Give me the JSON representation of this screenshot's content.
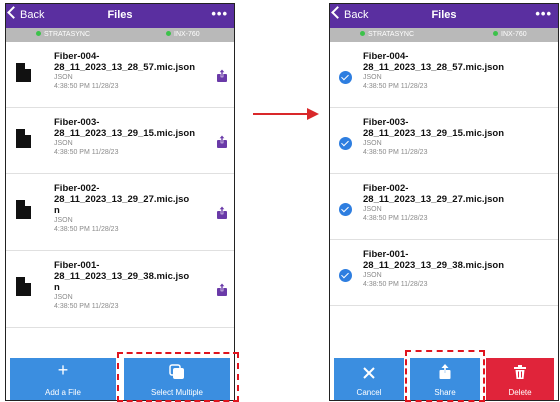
{
  "left": {
    "nav": {
      "back": "Back",
      "title": "Files",
      "menu": "•••"
    },
    "status": {
      "left": "STRATASYNC",
      "right": "INX-760"
    },
    "files": [
      {
        "name_lines": [
          "Fiber-004-",
          "28_11_2023_13_28_57.mic.json"
        ],
        "type": "JSON",
        "time": "4:38:50 PM 11/28/23"
      },
      {
        "name_lines": [
          "Fiber-003-",
          "28_11_2023_13_29_15.mic.json"
        ],
        "type": "JSON",
        "time": "4:38:50 PM 11/28/23"
      },
      {
        "name_lines": [
          "Fiber-002-",
          "28_11_2023_13_29_27.mic.jso",
          "n"
        ],
        "type": "JSON",
        "time": "4:38:50 PM 11/28/23"
      },
      {
        "name_lines": [
          "Fiber-001-",
          "28_11_2023_13_29_38.mic.jso",
          "n"
        ],
        "type": "JSON",
        "time": "4:38:50 PM 11/28/23"
      }
    ],
    "toolbar": {
      "add_label": "Add a File",
      "add_icon": "+",
      "select_label": "Select Multiple"
    }
  },
  "right": {
    "nav": {
      "back": "Back",
      "title": "Files",
      "menu": "•••"
    },
    "status": {
      "left": "STRATASYNC",
      "right": "INX-760"
    },
    "files": [
      {
        "name_lines": [
          "Fiber-004-",
          "28_11_2023_13_28_57.mic.json"
        ],
        "type": "JSON",
        "time": "4:38:50 PM 11/28/23"
      },
      {
        "name_lines": [
          "Fiber-003-",
          "28_11_2023_13_29_15.mic.json"
        ],
        "type": "JSON",
        "time": "4:38:50 PM 11/28/23"
      },
      {
        "name_lines": [
          "Fiber-002-",
          "28_11_2023_13_29_27.mic.json"
        ],
        "type": "JSON",
        "time": "4:38:50 PM 11/28/23"
      },
      {
        "name_lines": [
          "Fiber-001-",
          "28_11_2023_13_29_38.mic.json"
        ],
        "type": "JSON",
        "time": "4:38:50 PM 11/28/23"
      }
    ],
    "toolbar": {
      "cancel_label": "Cancel",
      "share_label": "Share",
      "delete_label": "Delete"
    }
  },
  "colors": {
    "navbar": "#5a2fa0",
    "toolbar_blue": "#3b8ee0",
    "delete_red": "#e0243a",
    "highlight_red": "#e0141e",
    "check_blue": "#2e7ee0",
    "share_purple": "#6a3aa8"
  }
}
